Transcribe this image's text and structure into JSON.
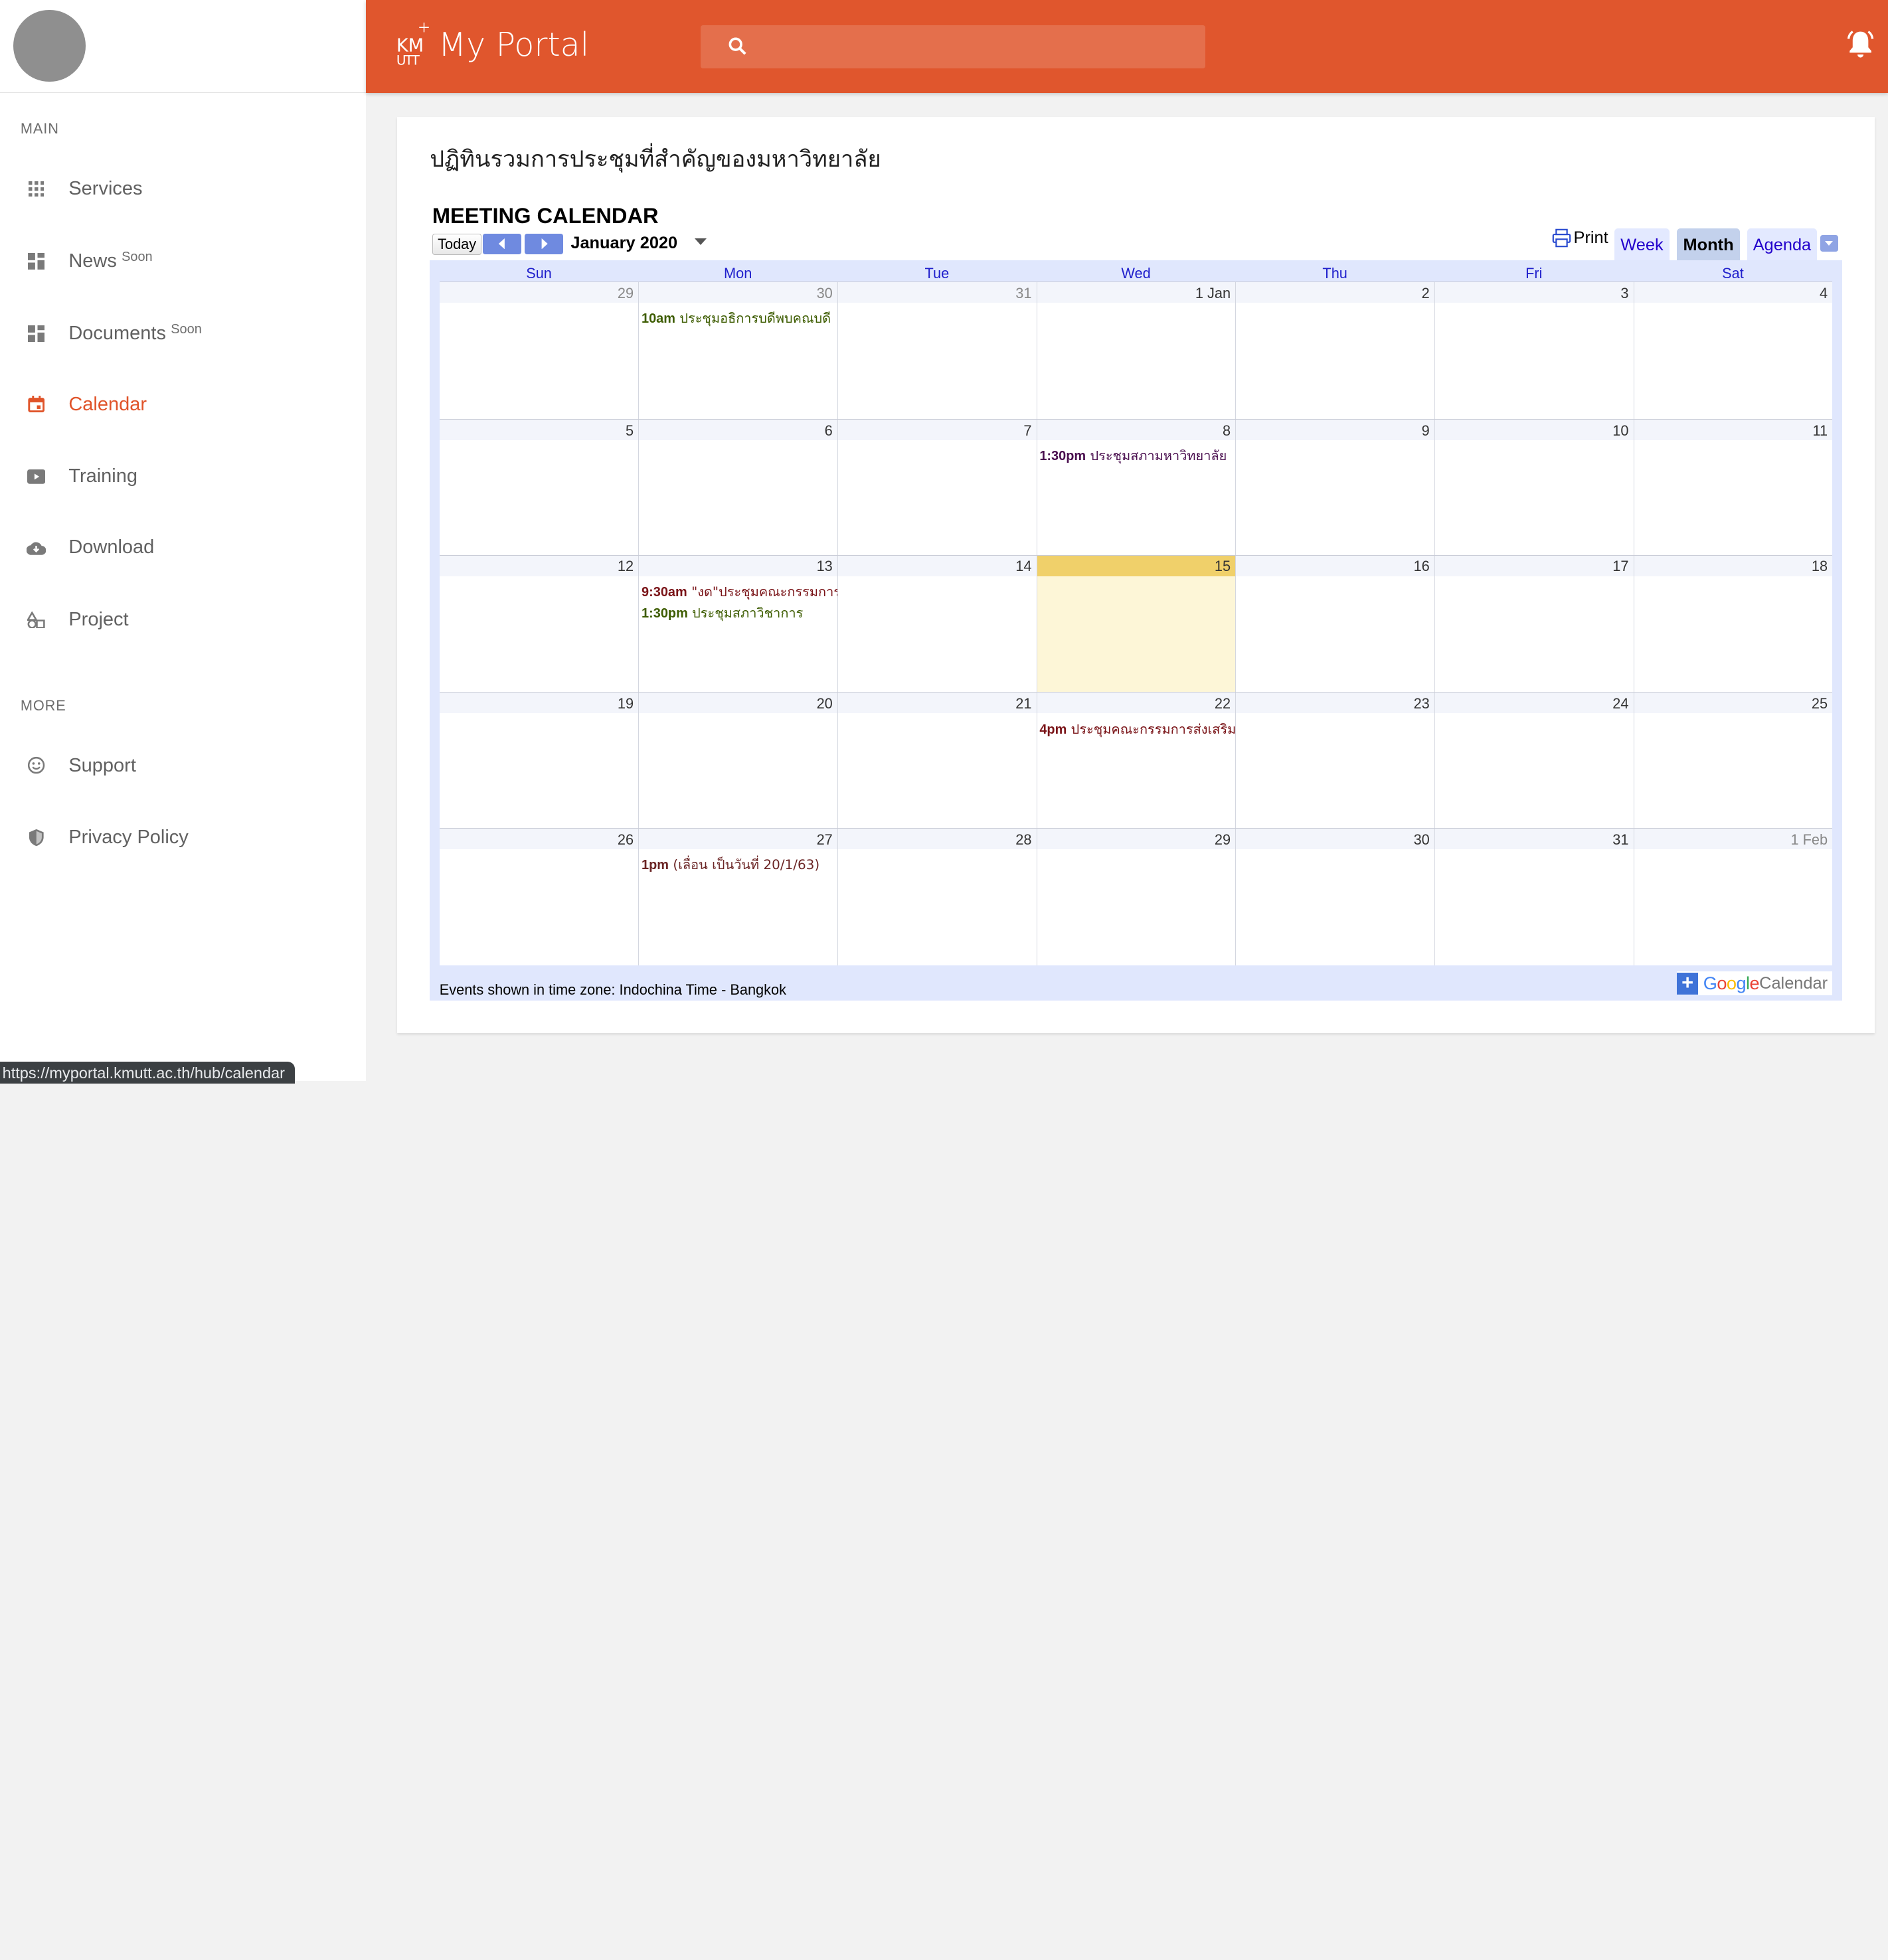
{
  "sidebar": {
    "main_label": "MAIN",
    "more_label": "MORE",
    "items": [
      {
        "label": "Services",
        "badge": ""
      },
      {
        "label": "News",
        "badge": "Soon"
      },
      {
        "label": "Documents",
        "badge": "Soon"
      },
      {
        "label": "Calendar",
        "badge": ""
      },
      {
        "label": "Training",
        "badge": ""
      },
      {
        "label": "Download",
        "badge": ""
      },
      {
        "label": "Project",
        "badge": ""
      }
    ],
    "more_items": [
      {
        "label": "Support"
      },
      {
        "label": "Privacy Policy"
      }
    ],
    "active": "Calendar"
  },
  "header": {
    "logo_mark": "KMUTT",
    "title": "My Portal",
    "search_placeholder": "",
    "accent": "#e0562d"
  },
  "page": {
    "title": "ปฏิทินรวมการประชุมที่สำคัญของมหาวิทยาลัย"
  },
  "calendar": {
    "title": "MEETING CALENDAR",
    "today_label": "Today",
    "month_label": "January 2020",
    "print_label": "Print",
    "tabs": [
      "Week",
      "Month",
      "Agenda"
    ],
    "selected_tab": "Month",
    "days_of_week": [
      "Sun",
      "Mon",
      "Tue",
      "Wed",
      "Thu",
      "Fri",
      "Sat"
    ],
    "weeks": [
      [
        "29",
        "30",
        "31",
        "1 Jan",
        "2",
        "3",
        "4"
      ],
      [
        "5",
        "6",
        "7",
        "8",
        "9",
        "10",
        "11"
      ],
      [
        "12",
        "13",
        "14",
        "15",
        "16",
        "17",
        "18"
      ],
      [
        "19",
        "20",
        "21",
        "22",
        "23",
        "24",
        "25"
      ],
      [
        "26",
        "27",
        "28",
        "29",
        "30",
        "31",
        "1 Feb"
      ]
    ],
    "events": {
      "w0_mon": {
        "time": "10am",
        "title": "ประชุมอธิการบดีพบคณบดี"
      },
      "w1_wed": {
        "time": "1:30pm",
        "title": "ประชุมสภามหาวิทยาลัย"
      },
      "w2_mon_a": {
        "time": "9:30am",
        "title": "\"งด\"ประชุมคณะกรรมการ"
      },
      "w2_mon_b": {
        "time": "1:30pm",
        "title": "ประชุมสภาวิชาการ"
      },
      "w3_wed": {
        "time": "4pm",
        "title": "ประชุมคณะกรรมการส่งเสริม"
      },
      "w4_mon": {
        "time": "1pm",
        "title": "(เลื่อน เป็นวันที่ 20/1/63)"
      }
    },
    "timezone": "Events shown in time zone: Indochina Time - Bangkok",
    "google_brand": "Google",
    "google_calendar": "Calendar"
  },
  "status_url": "https://myportal.kmutt.ac.th/hub/calendar"
}
